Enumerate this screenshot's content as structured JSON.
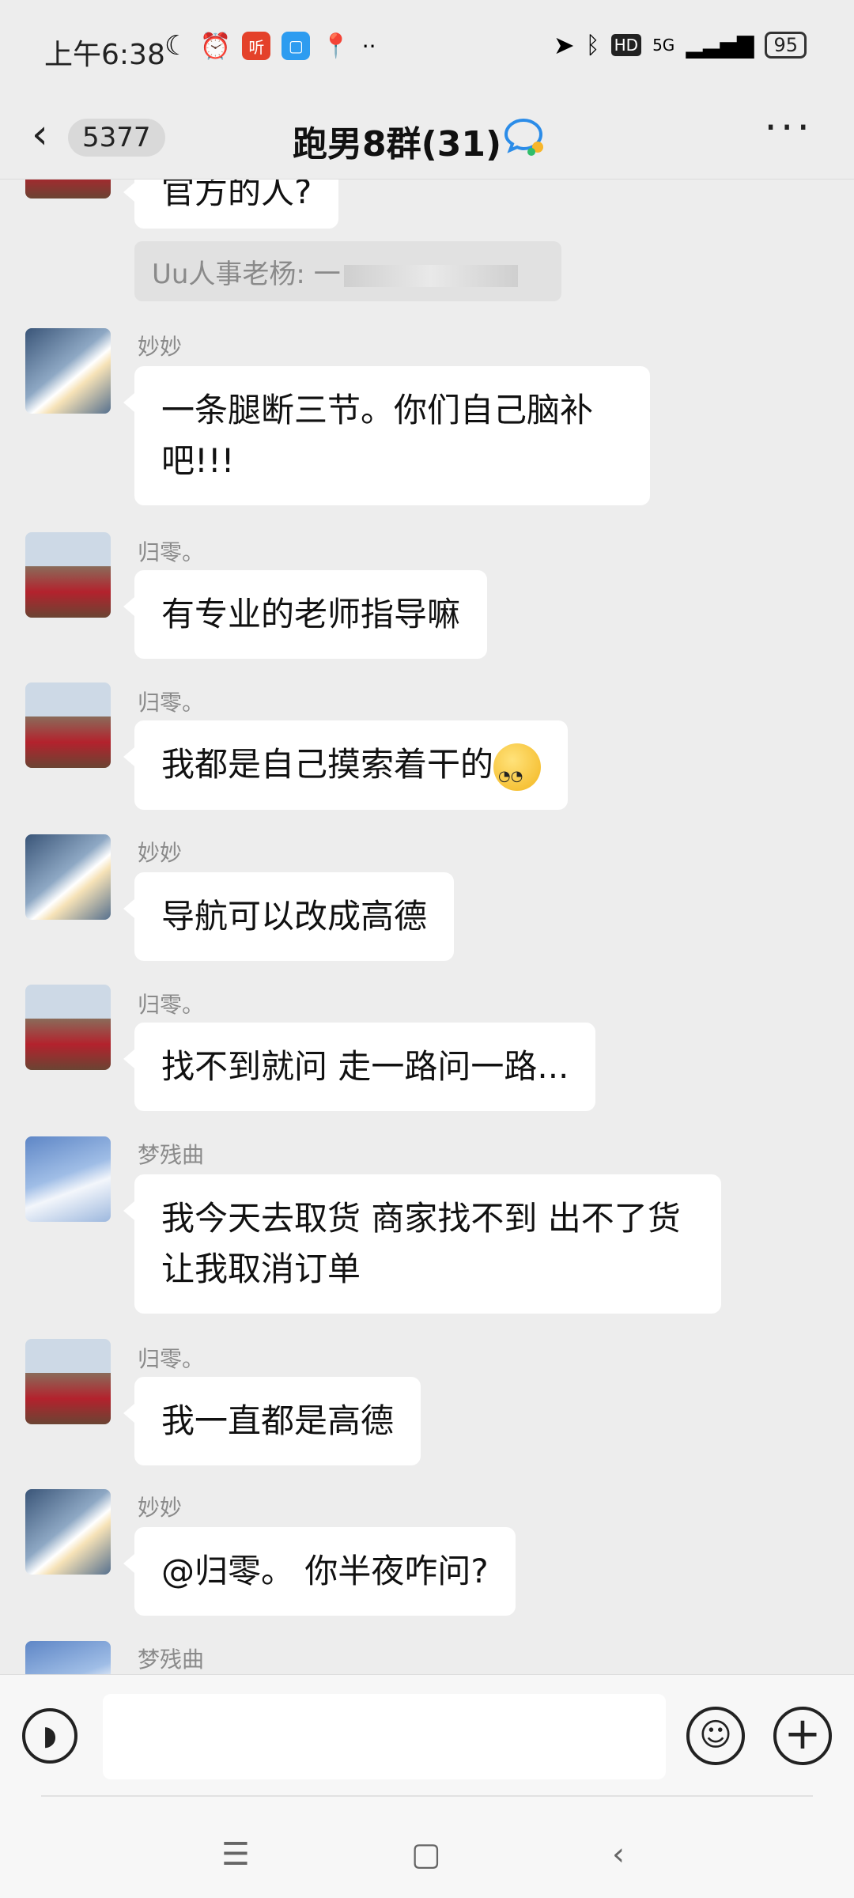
{
  "status_bar": {
    "time": "上午6:38",
    "app_icon_label": "听",
    "network": "5G",
    "battery": "95"
  },
  "header": {
    "unread_count": "5377",
    "title": "跑男8群(31)"
  },
  "quote": {
    "text": "Uu人事老杨: 一"
  },
  "messages": [
    {
      "text": "官方的人?"
    },
    {
      "sender": "妙妙",
      "text": "一条腿断三节。你们自己脑补吧!!!"
    },
    {
      "sender": "归零。",
      "text": "有专业的老师指导嘛"
    },
    {
      "sender": "归零。",
      "text": "我都是自己摸索着干的"
    },
    {
      "sender": "妙妙",
      "text": "导航可以改成高德"
    },
    {
      "sender": "归零。",
      "text": "找不到就问 走一路问一路..."
    },
    {
      "sender": "梦残曲",
      "text": "我今天去取货 商家找不到 出不了货让我取消订单"
    },
    {
      "sender": "归零。",
      "text": "我一直都是高德"
    },
    {
      "sender": "妙妙",
      "text": "@归零。 你半夜咋问?"
    },
    {
      "sender": "梦残曲"
    }
  ]
}
